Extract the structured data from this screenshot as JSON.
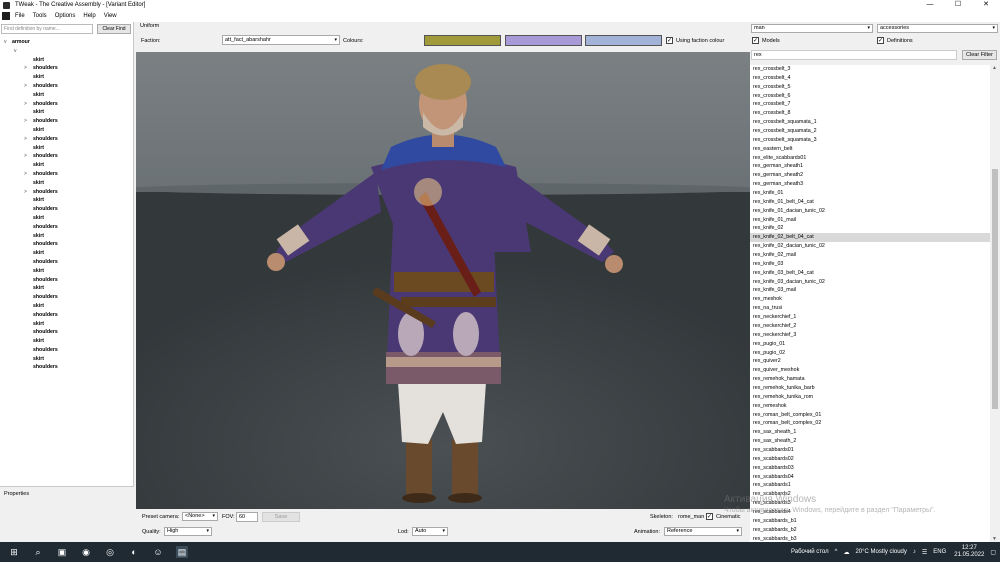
{
  "window": {
    "title": "TWeak - The Creative Assembly - [Variant Editor]",
    "controls": [
      "—",
      "☐",
      "✕"
    ]
  },
  "menu": [
    "File",
    "Tools",
    "Options",
    "Help",
    "View"
  ],
  "left": {
    "find_placeholder": "Find definition by name...",
    "clear_find": "Clear Find",
    "tree_root": "armour",
    "tree_items": [
      "skirt",
      "shoulders",
      "skirt",
      "shoulders",
      "skirt",
      "shoulders",
      "skirt",
      "shoulders",
      "skirt",
      "shoulders",
      "skirt",
      "shoulders",
      "skirt",
      "shoulders",
      "skirt",
      "shoulders",
      "skirt",
      "shoulders",
      "skirt",
      "shoulders",
      "skirt",
      "shoulders",
      "skirt",
      "shoulders",
      "skirt",
      "shoulders",
      "skirt",
      "shoulders",
      "skirt",
      "shoulders",
      "skirt",
      "shoulders",
      "skirt",
      "shoulders",
      "skirt",
      "shoulders"
    ],
    "properties_label": "Properties"
  },
  "center": {
    "uniform_label": "Uniform",
    "faction_label": "Faction:",
    "faction_value": "att_fact_abarshahr",
    "colours_label": "Colours:",
    "colours": [
      "#a09a3a",
      "#a79ad6",
      "#a3b3d8"
    ],
    "use_faction_colour": "Using faction colour",
    "preset_camera_label": "Preset camera:",
    "preset_camera_value": "<None>",
    "fov_label": "FOV:",
    "fov_value": "60",
    "save_label": "Save",
    "quality_label": "Quality:",
    "quality_value": "High",
    "lod_label": "Lod:",
    "lod_value": "Auto",
    "skeleton_label": "Skeleton:",
    "skeleton_value": "rome_man",
    "cinematic_label": "Cinematic",
    "animation_label": "Animation:",
    "animation_value": "Reference"
  },
  "right": {
    "category_value": "man",
    "type_value": "accessories",
    "models_label": "Models",
    "definitions_label": "Definitions",
    "filter_value": "rex",
    "clear_filter": "Clear Filter",
    "items": [
      "rex_crossbelt_3",
      "rex_crossbelt_4",
      "rex_crossbelt_5",
      "rex_crossbelt_6",
      "rex_crossbelt_7",
      "rex_crossbelt_8",
      "rex_crossbelt_squamata_1",
      "rex_crossbelt_squamata_2",
      "rex_crossbelt_squamata_3",
      "rex_eastern_belt",
      "rex_elite_scabbards01",
      "rex_german_sheath1",
      "rex_german_sheath2",
      "rex_german_sheath3",
      "rex_knife_01",
      "rex_knife_01_belt_04_cat",
      "rex_knife_01_dacian_tunic_02",
      "rex_knife_01_mail",
      "rex_knife_02",
      "rex_knife_02_belt_04_cat",
      "rex_knife_02_dacian_tunic_02",
      "rex_knife_02_mail",
      "rex_knife_03",
      "rex_knife_03_belt_04_cat",
      "rex_knife_03_dacian_tunic_02",
      "rex_knife_03_mail",
      "rex_meshok",
      "rex_na_trusi",
      "rex_neckerchief_1",
      "rex_neckerchief_2",
      "rex_neckerchief_3",
      "rex_pugio_01",
      "rex_pugio_02",
      "rex_quiver2",
      "rex_quiver_meshok",
      "rex_remehok_hamata",
      "rex_remehok_tunika_barb",
      "rex_remehok_tunika_rom",
      "rex_remeshok",
      "rex_roman_belt_complex_01",
      "rex_roman_belt_complex_02",
      "rex_sax_sheath_1",
      "rex_sax_sheath_2",
      "rex_scabbards01",
      "rex_scabbards02",
      "rex_scabbards03",
      "rex_scabbards04",
      "rex_scabbards1",
      "rex_scabbards2",
      "rex_scabbards3",
      "rex_scabbards4",
      "rex_scabbards_b1",
      "rex_scabbards_b2",
      "rex_scabbards_b3"
    ],
    "selected_index": 19
  },
  "watermark": {
    "line1": "Активация Windows",
    "line2": "Чтобы активировать Windows, перейдите в раздел \"Параметры\"."
  },
  "taskbar": {
    "desktop_label": "Рабочий стол",
    "weather": "20°C  Mostly cloudy",
    "lang": "ENG",
    "time": "12:27",
    "date": "21.05.2022"
  }
}
